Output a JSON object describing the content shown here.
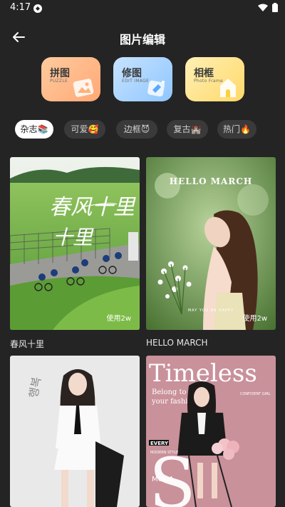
{
  "status": {
    "time": "4:17"
  },
  "header": {
    "title": "图片编辑"
  },
  "tools": [
    {
      "title": "拼图",
      "subtitle": "PUZZLE"
    },
    {
      "title": "修图",
      "subtitle": "EDIT IMAGE"
    },
    {
      "title": "相框",
      "subtitle": "Photo Frame"
    }
  ],
  "categories": [
    {
      "label": "杂志📚",
      "active": true
    },
    {
      "label": "可爱🥰",
      "active": false
    },
    {
      "label": "边框😈",
      "active": false
    },
    {
      "label": "复古🏰",
      "active": false
    },
    {
      "label": "热门🔥",
      "active": false
    }
  ],
  "posters": [
    {
      "title": "春风十里",
      "uses": "使用2w",
      "overlay_text": "春风十里"
    },
    {
      "title": "HELLO MARCH",
      "uses": "使用2w",
      "overlay_text": "HELLO MARCH",
      "small_text": "MAY YOU BE HAPPY"
    },
    {
      "title": "",
      "overlay_text": "행복의 순간"
    },
    {
      "title": "",
      "overlay_text": "Timeless",
      "sub_lines": [
        "Belong to",
        "your fashion",
        "CONFIDENT GIRL",
        "EVERY",
        "MODERN STYLE",
        "MODA"
      ]
    }
  ],
  "colors": {
    "background": "#242424",
    "chip": "#3a3a3a",
    "chip_active": "#ffffff"
  }
}
